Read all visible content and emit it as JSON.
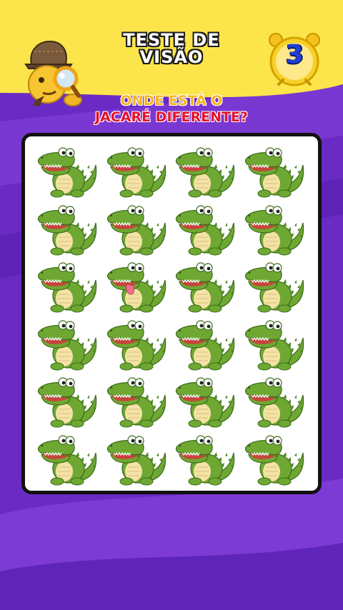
{
  "header": {
    "title_line1": "TESTE DE",
    "title_line2": "VISÃO",
    "timer_value": "3"
  },
  "question": {
    "line1": "ONDE ESTÁ O",
    "line2": "JACARÉ DIFERENTE?"
  },
  "colors": {
    "background_purple": "#6a2bc4",
    "header_yellow": "#fbe54a",
    "question_orange": "#f6b51c",
    "question_red": "#e3122c",
    "croc_green": "#6ea832",
    "tongue_pink": "#ef6f8f"
  },
  "puzzle": {
    "rows": 6,
    "columns": 4,
    "grid": [
      [
        "normal",
        "normal",
        "normal",
        "normal"
      ],
      [
        "normal",
        "normal",
        "normal",
        "normal"
      ],
      [
        "normal",
        "tongue",
        "normal",
        "normal"
      ],
      [
        "normal",
        "normal",
        "normal",
        "normal"
      ],
      [
        "normal",
        "normal",
        "normal",
        "normal"
      ],
      [
        "normal",
        "normal",
        "normal",
        "normal"
      ]
    ]
  },
  "icons": [
    "detective-emoji-icon",
    "magnifying-glass-icon",
    "alarm-clock-icon",
    "crocodile-icon"
  ]
}
